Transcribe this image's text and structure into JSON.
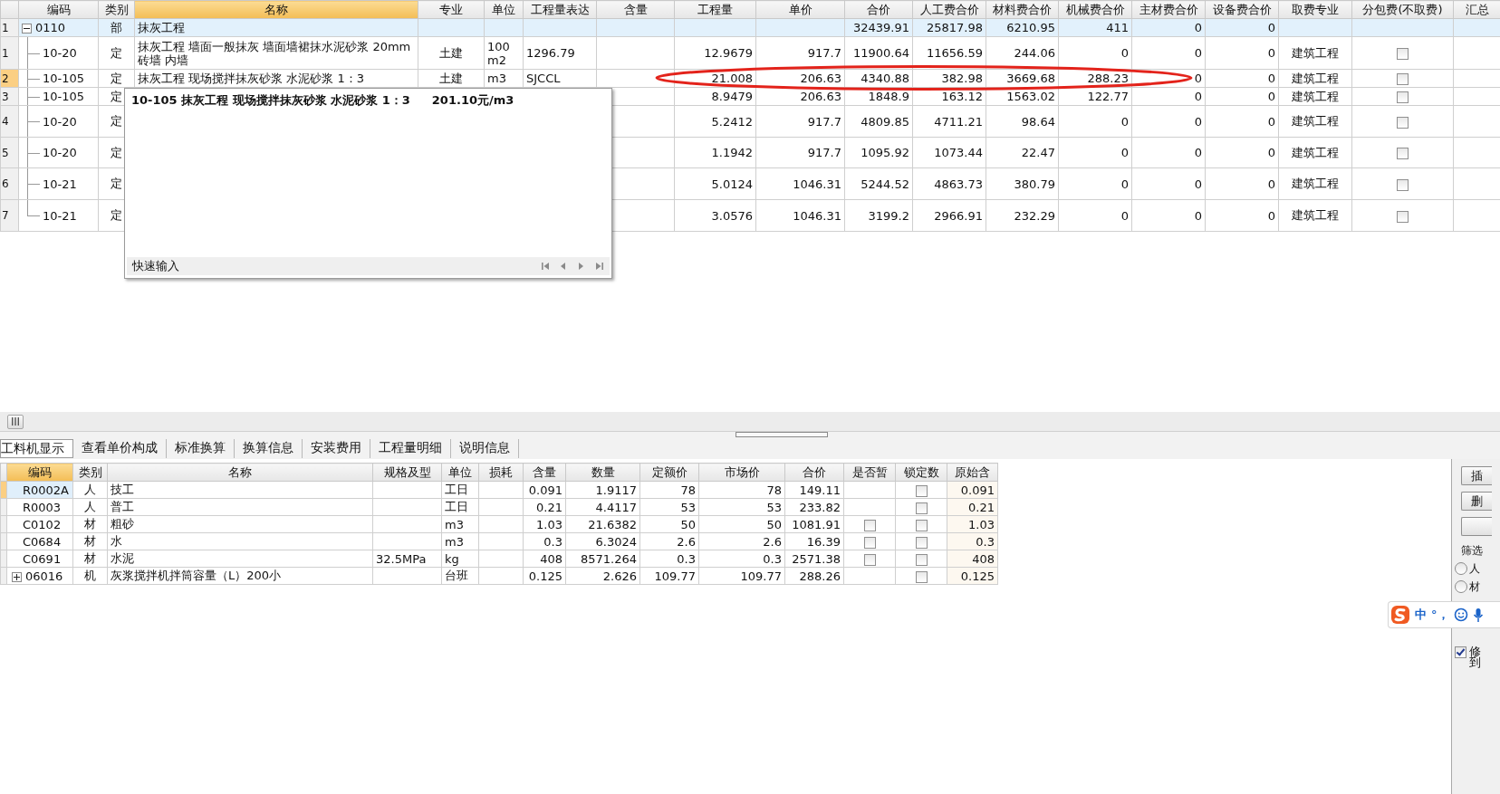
{
  "top_table": {
    "columns": [
      {
        "label": "编码",
        "selected": false
      },
      {
        "label": "类别",
        "selected": false
      },
      {
        "label": "名称",
        "selected": true
      },
      {
        "label": "专业",
        "selected": false
      },
      {
        "label": "单位",
        "selected": false
      },
      {
        "label": "工程量表达",
        "selected": false
      },
      {
        "label": "含量",
        "selected": false
      },
      {
        "label": "工程量",
        "selected": false
      },
      {
        "label": "单价",
        "selected": false
      },
      {
        "label": "合价",
        "selected": false
      },
      {
        "label": "人工费合价",
        "selected": false
      },
      {
        "label": "材料费合价",
        "selected": false
      },
      {
        "label": "机械费合价",
        "selected": false
      },
      {
        "label": "主材费合价",
        "selected": false
      },
      {
        "label": "设备费合价",
        "selected": false
      },
      {
        "label": "取费专业",
        "selected": false
      },
      {
        "label": "分包费(不取费)",
        "selected": false
      },
      {
        "label": "汇总",
        "selected": false
      }
    ],
    "rows": [
      {
        "num": "1",
        "code": "0110",
        "type": "部",
        "name": "抹灰工程",
        "total": "32439.91",
        "labor": "25817.98",
        "material": "6210.95",
        "machine": "411",
        "main_material": "0",
        "equipment": "0",
        "expanded": true,
        "selected": false,
        "children": [
          {
            "num": "1",
            "code": "10-20",
            "type": "定",
            "name": "抹灰工程 墙面一般抹灰 墙面墙裙抹水泥砂浆 20mm 砖墙 内墙",
            "major": "土建",
            "unit": "100m2",
            "expression": "1296.79",
            "quantity": "12.9679",
            "price": "917.7",
            "total": "11900.64",
            "labor": "11656.59",
            "material": "244.06",
            "machine": "0",
            "main_material": "0",
            "equipment": "0",
            "fee_major": "建筑工程",
            "subcontract": false,
            "selected": false,
            "circled": false
          },
          {
            "num": "2",
            "code": "10-105",
            "type": "定",
            "name": "抹灰工程 现场搅拌抹灰砂浆 水泥砂浆 1：3",
            "major": "土建",
            "unit": "m3",
            "expression": "SJCCL",
            "quantity": "21.008",
            "price": "206.63",
            "total": "4340.88",
            "labor": "382.98",
            "material": "3669.68",
            "machine": "288.23",
            "main_material": "0",
            "equipment": "0",
            "fee_major": "建筑工程",
            "subcontract": false,
            "selected": true,
            "circled": true
          },
          {
            "num": "3",
            "code": "10-105",
            "type": "定",
            "quantity": "8.9479",
            "price": "206.63",
            "total": "1848.9",
            "labor": "163.12",
            "material": "1563.02",
            "machine": "122.77",
            "main_material": "0",
            "equipment": "0",
            "fee_major": "建筑工程",
            "subcontract": false,
            "selected": false,
            "circled": false
          },
          {
            "num": "4",
            "code": "10-20",
            "type": "定",
            "quantity": "5.2412",
            "price": "917.7",
            "total": "4809.85",
            "labor": "4711.21",
            "material": "98.64",
            "machine": "0",
            "main_material": "0",
            "equipment": "0",
            "fee_major": "建筑工程",
            "subcontract": false,
            "selected": false,
            "circled": false
          },
          {
            "num": "5",
            "code": "10-20",
            "type": "定",
            "quantity": "1.1942",
            "price": "917.7",
            "total": "1095.92",
            "labor": "1073.44",
            "material": "22.47",
            "machine": "0",
            "main_material": "0",
            "equipment": "0",
            "fee_major": "建筑工程",
            "subcontract": false,
            "selected": false,
            "circled": false
          },
          {
            "num": "6",
            "code": "10-21",
            "type": "定",
            "quantity": "5.0124",
            "price": "1046.31",
            "total": "5244.52",
            "labor": "4863.73",
            "material": "380.79",
            "machine": "0",
            "main_material": "0",
            "equipment": "0",
            "fee_major": "建筑工程",
            "subcontract": false,
            "selected": false,
            "circled": false
          },
          {
            "num": "7",
            "code": "10-21",
            "type": "定",
            "quantity": "3.0576",
            "price": "1046.31",
            "total": "3199.2",
            "labor": "2966.91",
            "material": "232.29",
            "machine": "0",
            "main_material": "0",
            "equipment": "0",
            "fee_major": "建筑工程",
            "subcontract": false,
            "selected": false,
            "circled": false
          }
        ]
      }
    ]
  },
  "quick_input": {
    "title": "10-105 抹灰工程 现场搅拌抹灰砂浆 水泥砂浆 1：3",
    "price": "201.10元/m3",
    "footer": "快速输入"
  },
  "tabs": [
    {
      "label": "工料机显示",
      "selected": true
    },
    {
      "label": "查看单价构成",
      "selected": false
    },
    {
      "label": "标准换算",
      "selected": false
    },
    {
      "label": "换算信息",
      "selected": false
    },
    {
      "label": "安装费用",
      "selected": false
    },
    {
      "label": "工程量明细",
      "selected": false
    },
    {
      "label": "说明信息",
      "selected": false
    }
  ],
  "detail_table": {
    "columns": [
      {
        "label": "编码",
        "selected": true
      },
      {
        "label": "类别",
        "selected": false
      },
      {
        "label": "名称",
        "selected": false
      },
      {
        "label": "规格及型",
        "selected": false
      },
      {
        "label": "单位",
        "selected": false
      },
      {
        "label": "损耗",
        "selected": false
      },
      {
        "label": "含量",
        "selected": false
      },
      {
        "label": "数量",
        "selected": false
      },
      {
        "label": "定额价",
        "selected": false
      },
      {
        "label": "市场价",
        "selected": false
      },
      {
        "label": "合价",
        "selected": false
      },
      {
        "label": "是否暂",
        "selected": false
      },
      {
        "label": "锁定数",
        "selected": false
      },
      {
        "label": "原始含",
        "selected": false
      }
    ],
    "rows": [
      {
        "code": "R0002A",
        "type": "人",
        "name": "技工",
        "unit": "工日",
        "content": "0.091",
        "quantity": "1.9117",
        "quota_price": "78",
        "market_price": "78",
        "total": "149.11",
        "locked": false,
        "original": "0.091",
        "selected": true
      },
      {
        "code": "R0003",
        "type": "人",
        "name": "普工",
        "unit": "工日",
        "content": "0.21",
        "quantity": "4.4117",
        "quota_price": "53",
        "market_price": "53",
        "total": "233.82",
        "locked": false,
        "original": "0.21",
        "selected": false
      },
      {
        "code": "C0102",
        "type": "材",
        "name": "粗砂",
        "unit": "m3",
        "content": "1.03",
        "quantity": "21.6382",
        "quota_price": "50",
        "market_price": "50",
        "total": "1081.91",
        "provisional": false,
        "locked": false,
        "original": "1.03",
        "selected": false
      },
      {
        "code": "C0684",
        "type": "材",
        "name": "水",
        "unit": "m3",
        "content": "0.3",
        "quantity": "6.3024",
        "quota_price": "2.6",
        "market_price": "2.6",
        "total": "16.39",
        "provisional": false,
        "locked": false,
        "original": "0.3",
        "selected": false
      },
      {
        "code": "C0691",
        "type": "材",
        "name": "水泥",
        "spec": "32.5MPa",
        "unit": "kg",
        "content": "408",
        "quantity": "8571.264",
        "quota_price": "0.3",
        "market_price": "0.3",
        "total": "2571.38",
        "provisional": false,
        "locked": false,
        "original": "408",
        "selected": false
      },
      {
        "code": "06016",
        "type": "机",
        "name": "灰浆搅拌机拌筒容量（L）200小",
        "unit": "台班",
        "content": "0.125",
        "quantity": "2.626",
        "quota_price": "109.77",
        "market_price": "109.77",
        "total": "288.26",
        "locked": false,
        "original": "0.125",
        "selected": false,
        "expanded": false
      }
    ]
  },
  "side_panel": {
    "buttons": [
      {
        "kind": "labeled",
        "label": "插"
      },
      {
        "kind": "labeled",
        "label": "删"
      },
      {
        "kind": "blank"
      }
    ],
    "filter": {
      "label": "筛选",
      "options": [
        {
          "label": "人",
          "selected": false
        },
        {
          "label": "材",
          "selected": false
        }
      ]
    },
    "checkbox": {
      "lines": [
        "修",
        "到"
      ],
      "checked": true
    }
  },
  "ime_toolbar": {
    "mode": "中",
    "punctuation": "°，"
  }
}
